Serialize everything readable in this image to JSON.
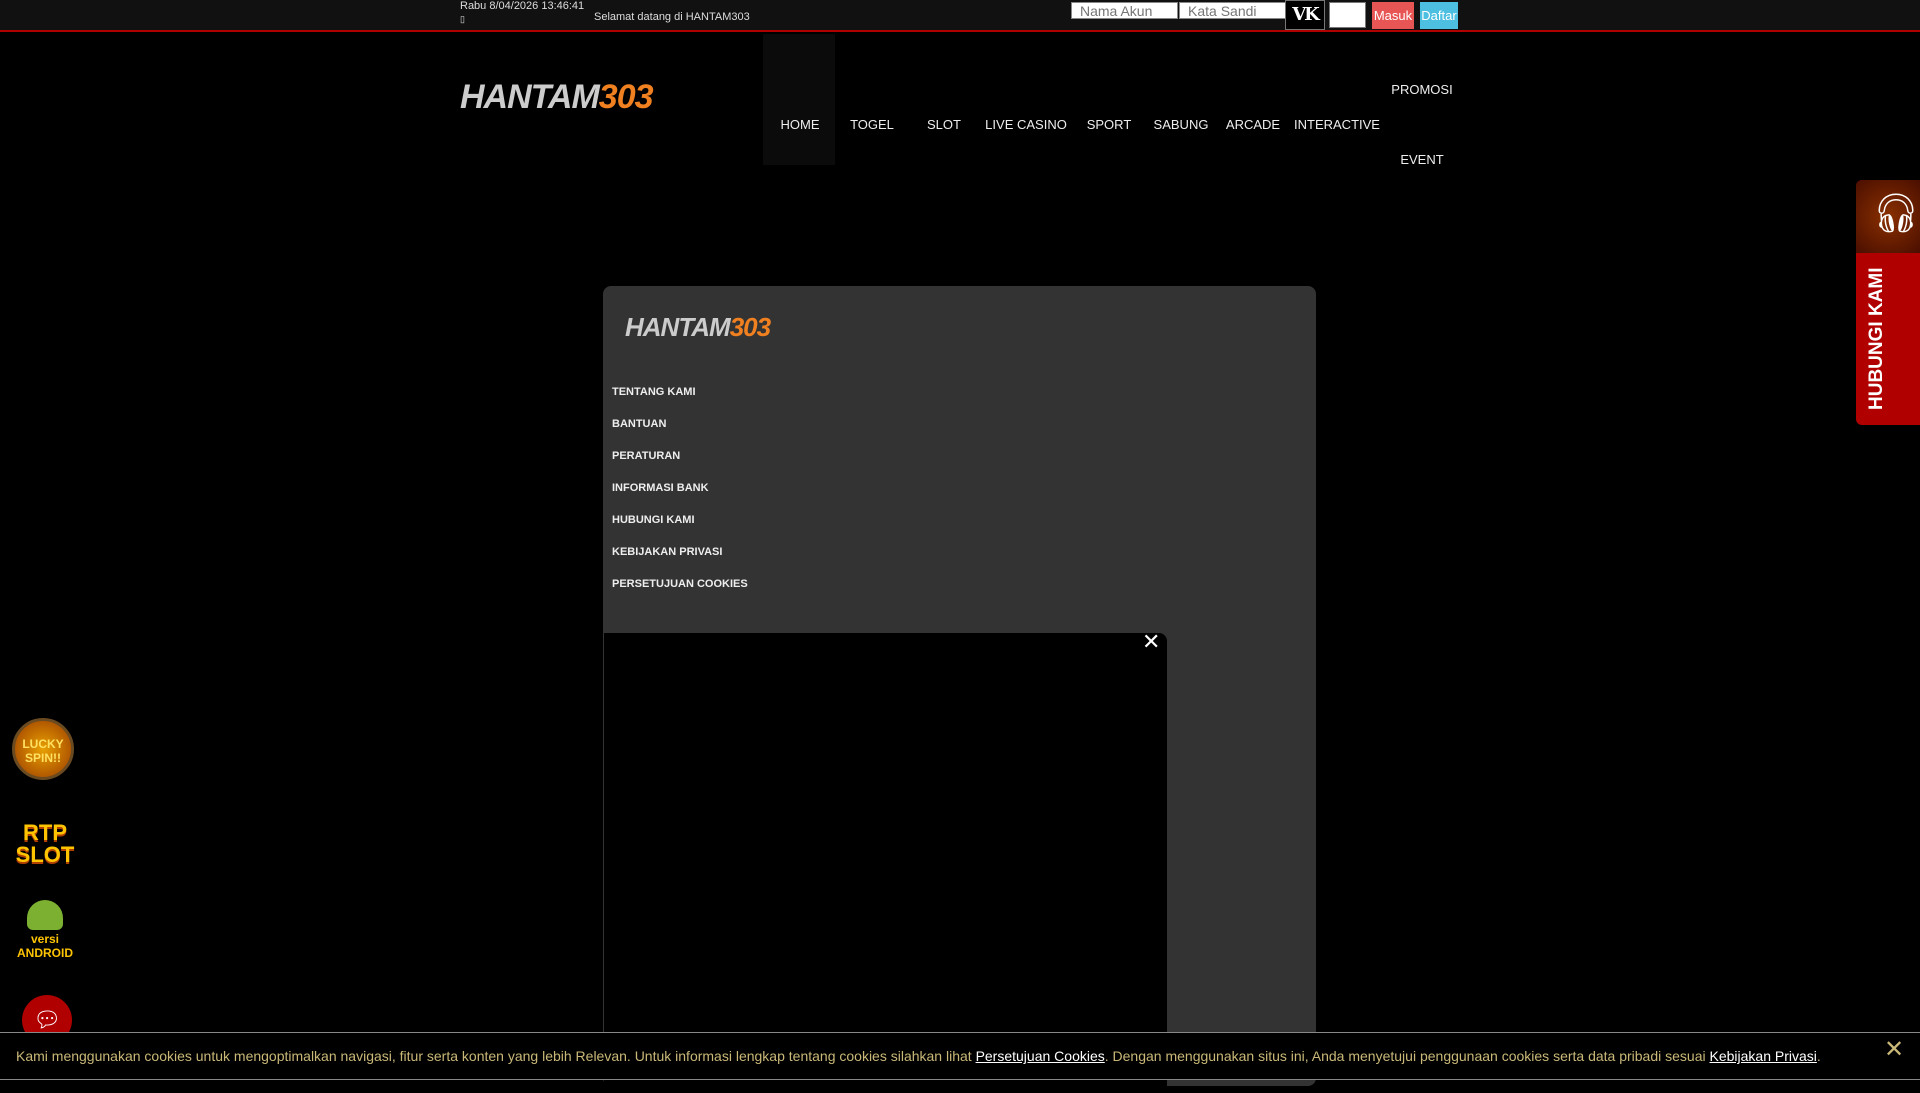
{
  "topbar": {
    "datetime": "Rabu 8/04/2026 13:46:41",
    "date_icon": "▯",
    "welcome": "Selamat datang di HANTAM303",
    "username_placeholder": "Nama Akun",
    "password_placeholder": "Kata Sandi",
    "captcha_text": "VK",
    "login_label": "Masuk",
    "register_label": "Daftar"
  },
  "logo": {
    "text1": "HANTAM",
    "text2": "303"
  },
  "nav": [
    {
      "label": "HOME"
    },
    {
      "label": "TOGEL"
    },
    {
      "label": "SLOT"
    },
    {
      "label": "LIVE CASINO"
    },
    {
      "label": "SPORT"
    },
    {
      "label": "SABUNG"
    },
    {
      "label": "ARCADE"
    },
    {
      "label": "INTERACTIVE"
    },
    {
      "label": "PROMOSI"
    },
    {
      "label": "EVENT"
    }
  ],
  "panel": {
    "items": [
      {
        "label": "TENTANG KAMI"
      },
      {
        "label": "BANTUAN"
      },
      {
        "label": "PERATURAN"
      },
      {
        "label": "INFORMASI BANK"
      },
      {
        "label": "HUBUNGI KAMI"
      },
      {
        "label": "KEBIJAKAN PRIVASI"
      },
      {
        "label": "PERSETUJUAN COOKIES"
      }
    ],
    "close": "✕"
  },
  "contact_widget": {
    "label": "HUBUNGI KAMI",
    "icon": "headset-icon"
  },
  "left_icons": {
    "lucky": "LUCKY SPIN!!",
    "rtp": "RTP SLOT",
    "android_1": "versi",
    "android_2": "ANDROID"
  },
  "cookie": {
    "text1": "Kami menggunakan cookies untuk mengoptimalkan navigasi, fitur serta konten yang lebih Relevan. Untuk informasi lengkap tentang cookies silahkan lihat ",
    "link1": "Persetujuan Cookies",
    "text2": ". Dengan menggunakan situs ini, Anda menyetujui penggunaan cookies serta data pribadi sesuai ",
    "link2": "Kebijakan Privasi",
    "text3": ".",
    "close": "✕"
  },
  "colors": {
    "accent": "#b00000",
    "login": "#e85555",
    "register": "#4dbfe0",
    "cookie_text": "#c9b878"
  }
}
